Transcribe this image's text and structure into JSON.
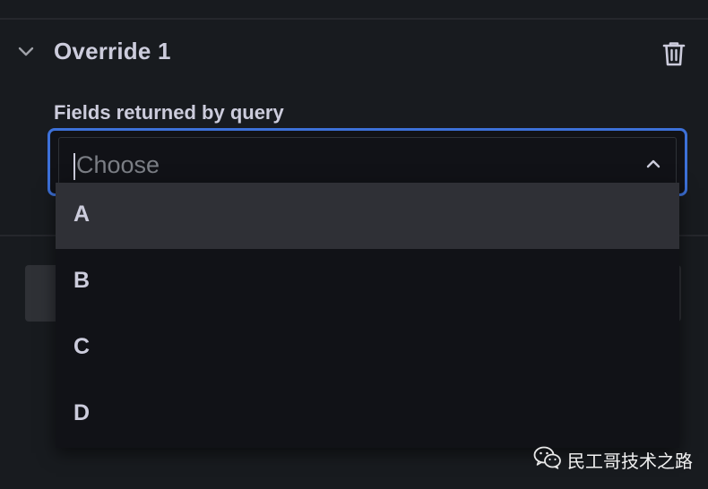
{
  "override": {
    "title": "Override 1",
    "field_label": "Fields returned by query",
    "select": {
      "placeholder": "Choose",
      "value": "",
      "options": [
        {
          "label": "A",
          "highlighted": true
        },
        {
          "label": "B",
          "highlighted": false
        },
        {
          "label": "C",
          "highlighted": false
        },
        {
          "label": "D",
          "highlighted": false
        }
      ]
    }
  },
  "icons": {
    "collapse": "chevron-down-icon",
    "delete": "trash-icon",
    "dropdown": "chevron-up-icon",
    "watermark": "wechat-icon"
  },
  "colors": {
    "background": "#181b1f",
    "focus_border": "#3d71d9",
    "menu_background": "#111217",
    "highlight": "#2f3036",
    "text": "#ccccdc"
  },
  "watermark": {
    "text": "民工哥技术之路"
  }
}
